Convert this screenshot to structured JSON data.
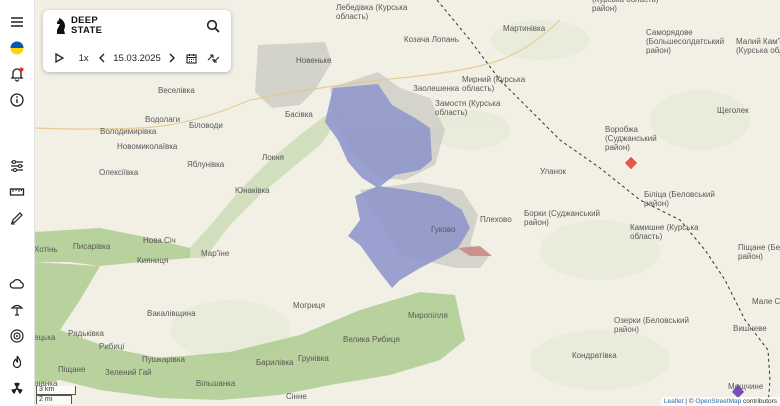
{
  "app": {
    "logo_line1": "DEEP",
    "logo_line2": "STATE"
  },
  "timeline": {
    "speed": "1x",
    "date": "15.03.2025"
  },
  "sidebar": {
    "icons": [
      "menu-icon",
      "ukraine-flag-icon",
      "notifications-icon",
      "info-icon",
      "filters-icon",
      "ruler-icon",
      "draw-icon",
      "weather-icon",
      "explosion-icon",
      "target-icon",
      "fire-icon",
      "radiation-icon"
    ]
  },
  "colors": {
    "occupied": "#8e96cc",
    "liberated_green": "#a8c98a",
    "gray_zone": "#c9c9c3",
    "contested_red": "#c98a86",
    "land": "#f2efe5",
    "border_line": "#333333"
  },
  "places": {
    "lebedivka": "Лебедівка (Курська\nобласть)",
    "kozacha_lopan": "Козача Лопань",
    "martynivka": "Мартинівка",
    "top_right_partial": "(Курська область)\nрайон)",
    "samoriadove": "Саморядове\n(Большесолдатський\nрайон)",
    "malyi_kamin": "Малий Кам'ї\n(Курська обла",
    "novenke": "Новеньке",
    "mirnyi": "Мирний (Курська\nобласть)",
    "zaoleshenka": "Заолешенка",
    "zamostia": "Замостя (Курська\nобласть)",
    "veselivka": "Веселівка",
    "basivka": "Басівка",
    "scheholek": "Щеголек",
    "volodymyrivka": "Володимирівка",
    "vodolagy": "Водолаги",
    "bilovody": "Біловоди",
    "vorobzha": "Воробжа\n(Суджанський\nрайон)",
    "novomykolaivka": "Новомиколаївка",
    "yablunivka": "Яблунівка",
    "lokhnia": "Локня",
    "oleksiivka": "Олексіївка",
    "yunakivka": "Юнаківка",
    "ulanok": "Уланок",
    "bilytsia": "Біліца (Беловський\nрайон)",
    "borky": "Борки (Суджанський\nрайон)",
    "plekhovo": "Плехово",
    "kamyshne": "Камишне (Курська\nобласть)",
    "hukovo": "Гуково",
    "nova_sich": "Нова Січ",
    "pysarivka": "Писарівка",
    "khotin": "Хотінь",
    "kyianytsia": "Кияниця",
    "marine": "Мар'їне",
    "pischane": "Піщане (Беловськ\nрайон)",
    "male_soldatske": "Мале Сол",
    "mohrytsia": "Могриця",
    "myropillia": "Миропілля",
    "vakalivshchyna": "Вакалівщина",
    "ozerky": "Озерки (Беловський\nрайон)",
    "radkivka": "Радьківка",
    "velyka_rybytsia": "Велика Рибиця",
    "vyshneve": "Вишневе",
    "rybytsi": "Рибиці",
    "kondrativka": "Кондратівка",
    "pushkarivka": "Пушкарівка",
    "barylivka": "Барилівка",
    "grunivka": "Грунівка",
    "pischane2": "Піщане",
    "zelenyi_hai": "Зелений Гай",
    "vilshanka": "Вільшанка",
    "moshchyne": "Мощчине",
    "sinne": "Сінне",
    "shanka": "шанка",
    "etska": "ецька"
  },
  "scale": {
    "km": "3 km",
    "mi": "2 mi"
  },
  "attribution": {
    "leaflet": "Leaflet",
    "separator": " | © ",
    "osm": "OpenStreetMap",
    "contributors": " contributors"
  }
}
